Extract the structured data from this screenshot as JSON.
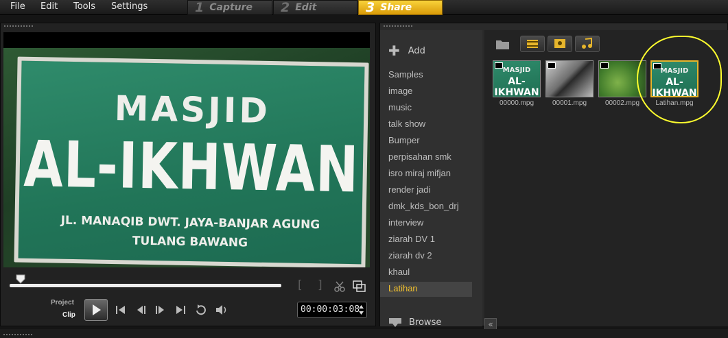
{
  "menu": [
    "File",
    "Edit",
    "Tools",
    "Settings"
  ],
  "steps": [
    {
      "num": "1",
      "label": "Capture",
      "active": false
    },
    {
      "num": "2",
      "label": "Edit",
      "active": false
    },
    {
      "num": "3",
      "label": "Share",
      "active": true
    }
  ],
  "preview": {
    "sign_line1": "MASJID",
    "sign_line2": "AL-IKHWAN",
    "sign_line3": "JL. MANAQIB DWT. JAYA-BANJAR AGUNG",
    "sign_line4": "TULANG BAWANG",
    "project_label": "Project",
    "clip_label": "Clip",
    "timecode": "00:00:03:08",
    "mark_in": "[",
    "mark_out": "]",
    "scrub_position": 0.04
  },
  "library": {
    "add_label": "Add",
    "folders": [
      "Samples",
      "image",
      "music",
      "talk show",
      "Bumper",
      "perpisahan smk",
      "isro miraj mifjan",
      "render jadi",
      "dmk_kds_bon_drj",
      "interview",
      "ziarah DV 1",
      "ziarah dv 2",
      "khaul",
      "Latihan"
    ],
    "selected_folder": "Latihan",
    "browse_label": "Browse",
    "thumbnails": [
      {
        "name": "00000.mpg",
        "kind": "sign",
        "selected": false
      },
      {
        "name": "00001.mpg",
        "kind": "roof",
        "selected": false
      },
      {
        "name": "00002.mpg",
        "kind": "tree",
        "selected": false
      },
      {
        "name": "Latihan.mpg",
        "kind": "sign",
        "selected": true
      }
    ],
    "thumb_sign_line1": "MASJID",
    "thumb_sign_line2": "AL-IKHWAN"
  },
  "colors": {
    "accent": "#f2c12e",
    "share_step": "#e9b21f",
    "highlight_annotation": "#ffff2e",
    "sign_green": "#217558"
  }
}
